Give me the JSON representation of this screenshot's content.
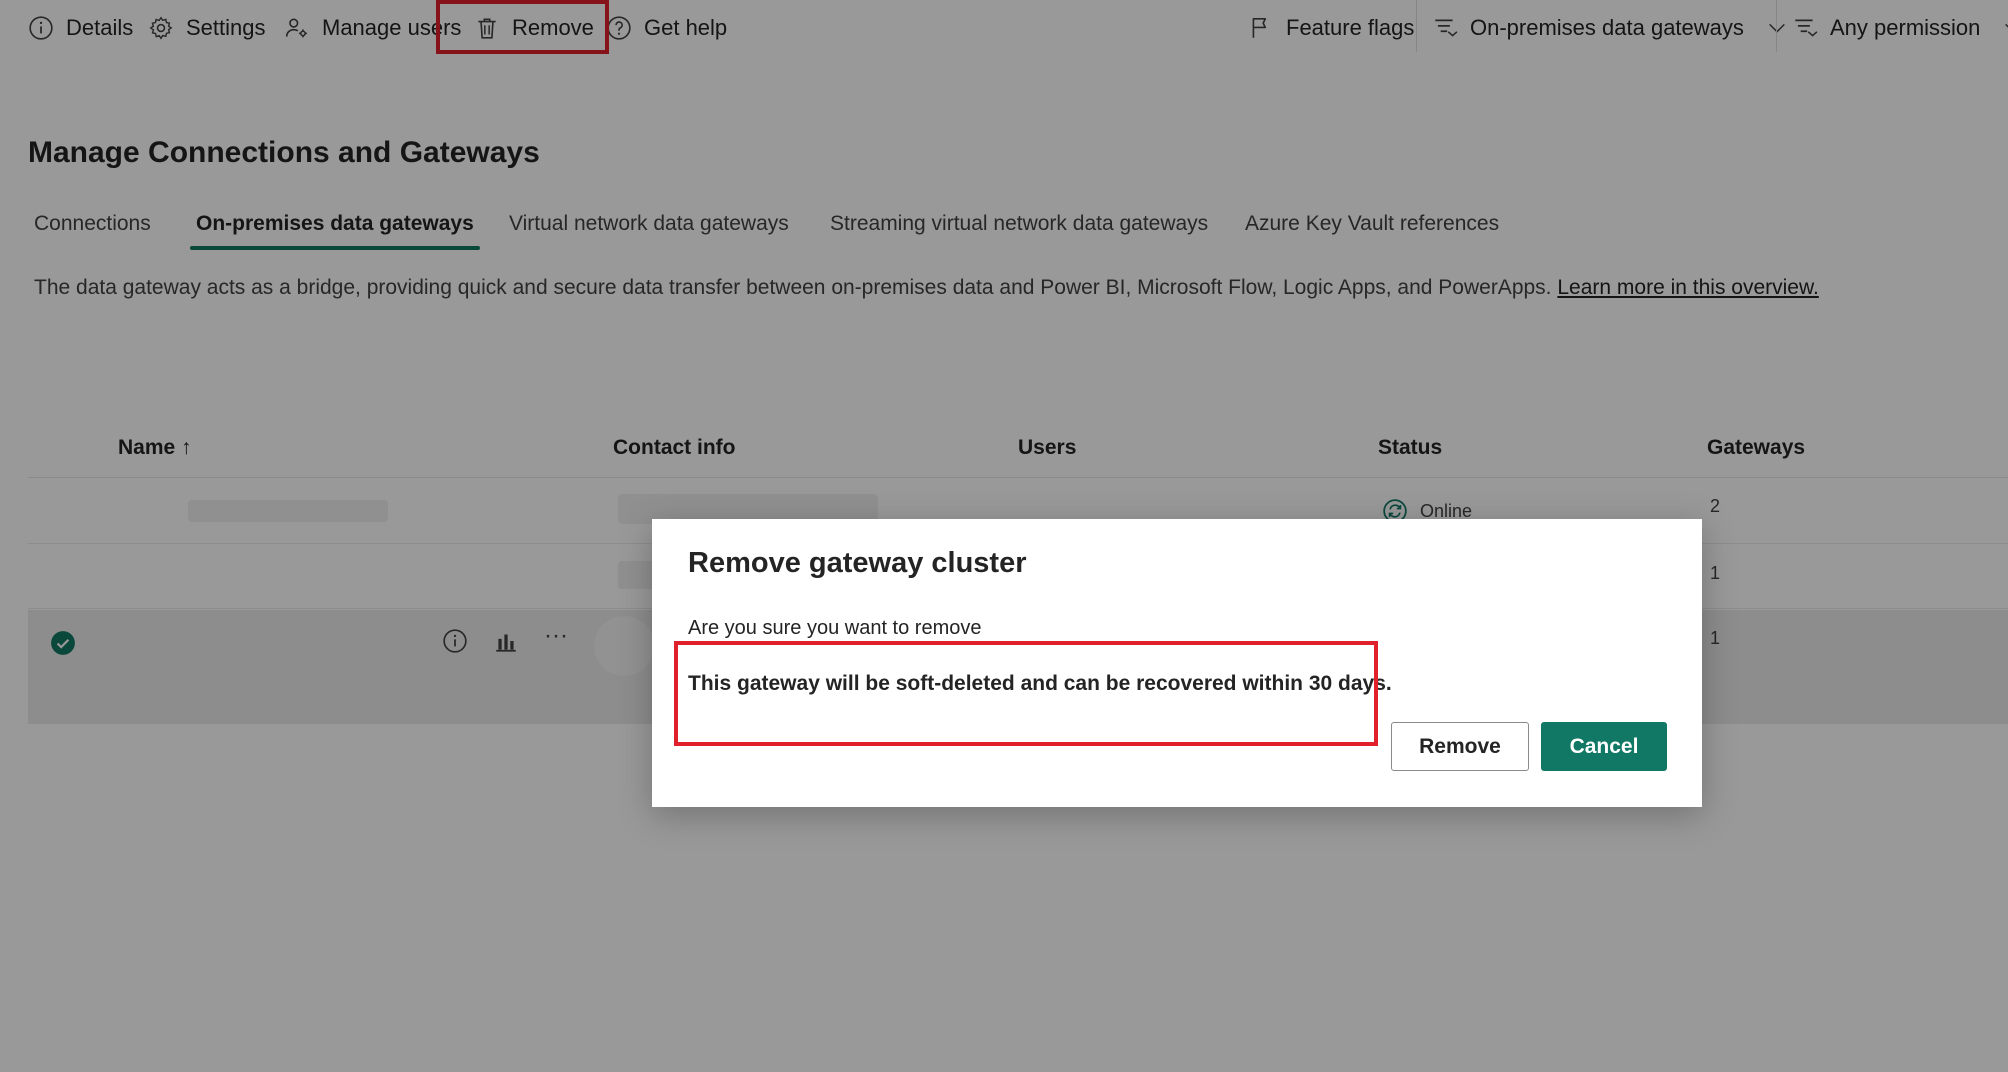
{
  "toolbar": {
    "details_label": "Details",
    "settings_label": "Settings",
    "manage_users_label": "Manage users",
    "remove_label": "Remove",
    "get_help_label": "Get help",
    "feature_flags_label": "Feature flags",
    "gateway_filter_label": "On-premises data gateways",
    "permission_filter_label": "Any permission"
  },
  "page": {
    "title": "Manage Connections and Gateways",
    "tabs": [
      {
        "label": "Connections",
        "active": false
      },
      {
        "label": "On-premises data gateways",
        "active": true
      },
      {
        "label": "Virtual network data gateways",
        "active": false
      },
      {
        "label": "Streaming virtual network data gateways",
        "active": false
      },
      {
        "label": "Azure Key Vault references",
        "active": false
      }
    ],
    "description": "The data gateway acts as a bridge, providing quick and secure data transfer between on-premises data and Power BI, Microsoft Flow, Logic Apps, and PowerApps.",
    "learn_more_link": "Learn more in this overview."
  },
  "table": {
    "columns": [
      "Name ↑",
      "Contact info",
      "Users",
      "Status",
      "Gateways"
    ],
    "rows": [
      {
        "status": "Online",
        "gateways": "2",
        "selected": false
      },
      {
        "status": "",
        "gateways": "1",
        "selected": false
      },
      {
        "status": "",
        "gateways": "1",
        "selected": true
      }
    ],
    "more_glyph": "···"
  },
  "dialog": {
    "title": "Remove gateway cluster",
    "question": "Are you sure you want to remove",
    "warning": "This gateway will be soft-deleted and can be recovered within 30 days.",
    "remove_label": "Remove",
    "cancel_label": "Cancel"
  },
  "colors": {
    "accent": "#117865",
    "highlight": "#e0202a",
    "overlay": "rgba(0,0,0,0.40)"
  }
}
